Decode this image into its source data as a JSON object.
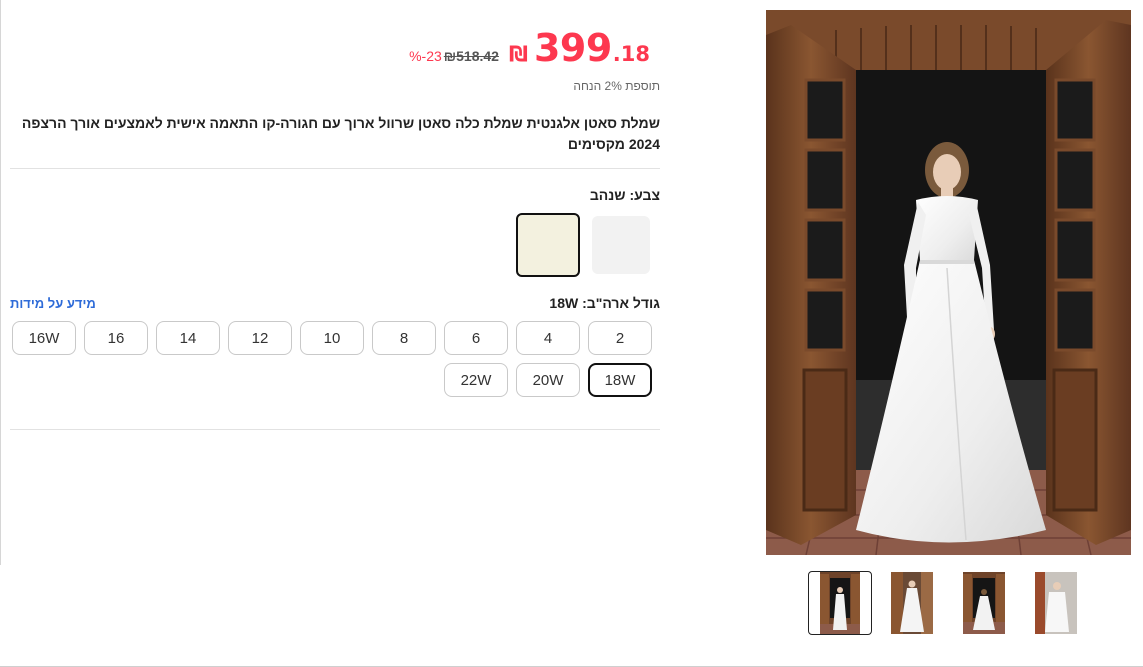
{
  "product": {
    "price": {
      "integer": "399",
      "decimal": ".18",
      "currency": "₪",
      "old_price": "518.42",
      "old_currency": "₪",
      "discount": "-23",
      "discount_unit": "%"
    },
    "bonus_text": "תוספת 2% הנחה",
    "title": "שמלת סאטן אלגנטית שמלת כלה סאטן שרוול ארוך עם חגורה-קו התאמה אישית לאמצעים אורך הרצפה 2024 מקסימים",
    "color": {
      "label": "צבע: שנהב",
      "swatches": [
        {
          "name": "white",
          "hex": "#f2f2f2",
          "selected": false
        },
        {
          "name": "ivory",
          "hex": "#f3f1df",
          "selected": true
        }
      ]
    },
    "size": {
      "label": "גודל ארה\"ב: 18W",
      "info_link": "מידע על מידות",
      "options": [
        "2",
        "4",
        "6",
        "8",
        "10",
        "12",
        "14",
        "16",
        "16W",
        "18W",
        "20W",
        "22W"
      ],
      "selected": "18W"
    }
  },
  "gallery": {
    "thumbnail_count": 4,
    "active_thumbnail": 1
  },
  "colors": {
    "price_red": "#fd384f",
    "link_blue": "#2e6bd8",
    "selected_border": "#111111"
  }
}
